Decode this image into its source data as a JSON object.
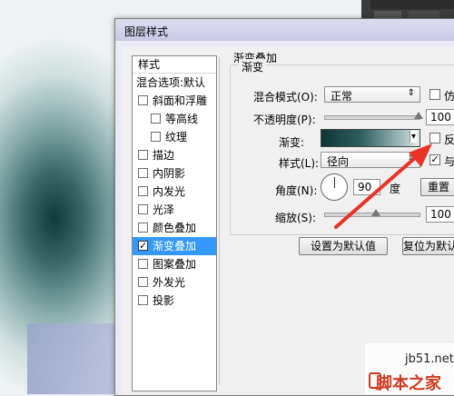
{
  "dialog": {
    "title": "图层样式"
  },
  "left_panel": {
    "header": "样式",
    "blend_options": "混合选项:默认",
    "items": [
      {
        "label": "斜面和浮雕",
        "checked": false,
        "indent": false
      },
      {
        "label": "等高线",
        "checked": false,
        "indent": true
      },
      {
        "label": "纹理",
        "checked": false,
        "indent": true
      },
      {
        "label": "描边",
        "checked": false,
        "indent": false
      },
      {
        "label": "内阴影",
        "checked": false,
        "indent": false
      },
      {
        "label": "内发光",
        "checked": false,
        "indent": false
      },
      {
        "label": "光泽",
        "checked": false,
        "indent": false
      },
      {
        "label": "颜色叠加",
        "checked": false,
        "indent": false
      },
      {
        "label": "渐变叠加",
        "checked": true,
        "indent": false,
        "selected": true
      },
      {
        "label": "图案叠加",
        "checked": false,
        "indent": false
      },
      {
        "label": "外发光",
        "checked": false,
        "indent": false
      },
      {
        "label": "投影",
        "checked": false,
        "indent": false
      }
    ]
  },
  "gradient_overlay": {
    "section_title": "渐变叠加",
    "group_title": "渐变",
    "blend_mode_label": "混合模式(O):",
    "blend_mode_value": "正常",
    "dither_label": "仿",
    "opacity_label": "不透明度(P):",
    "opacity_value": "100",
    "opacity_percent": 100,
    "gradient_label": "渐变:",
    "reverse_label": "反",
    "style_label": "样式(L):",
    "style_value": "径向",
    "align_label": "与",
    "angle_label": "角度(N):",
    "angle_value": "90",
    "angle_unit": "度",
    "reset_label": "重置",
    "scale_label": "缩放(S):",
    "scale_value": "100",
    "scale_percent": 100,
    "make_default": "设置为默认值",
    "reset_default": "复位为默认"
  },
  "watermark": {
    "line1": "jb51.net",
    "line2": "脚本之家"
  },
  "colors": {
    "selected": "#3399ff",
    "annotation_arrow": "#e8332a"
  }
}
